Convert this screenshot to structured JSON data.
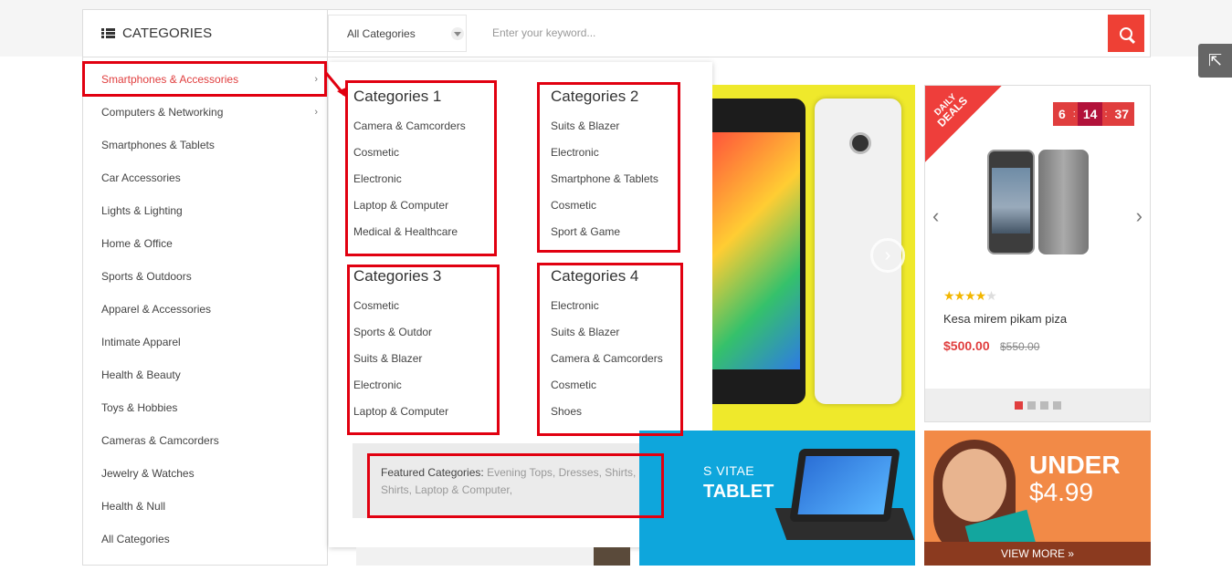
{
  "header": {
    "categories_title": "CATEGORIES",
    "search": {
      "select_value": "All Categories",
      "placeholder": "Enter your keyword..."
    }
  },
  "sidebar": {
    "items": [
      {
        "label": "Smartphones & Accessories",
        "has_sub": true
      },
      {
        "label": "Computers & Networking",
        "has_sub": true
      },
      {
        "label": "Smartphones & Tablets"
      },
      {
        "label": "Car Accessories"
      },
      {
        "label": "Lights & Lighting"
      },
      {
        "label": "Home & Office"
      },
      {
        "label": "Sports & Outdoors"
      },
      {
        "label": "Apparel & Accessories"
      },
      {
        "label": "Intimate Apparel"
      },
      {
        "label": "Health & Beauty"
      },
      {
        "label": "Toys & Hobbies"
      },
      {
        "label": "Cameras & Camcorders"
      },
      {
        "label": "Jewelry & Watches"
      },
      {
        "label": "Health & Null"
      },
      {
        "label": "All Categories"
      }
    ]
  },
  "mega": {
    "columns": [
      {
        "title": "Categories 1",
        "links": [
          "Camera & Camcorders",
          "Cosmetic",
          "Electronic",
          "Laptop & Computer",
          "Medical & Healthcare"
        ]
      },
      {
        "title": "Categories 2",
        "links": [
          "Suits & Blazer",
          "Electronic",
          "Smartphone & Tablets",
          "Cosmetic",
          "Sport & Game"
        ]
      },
      {
        "title": "Categories 3",
        "links": [
          "Cosmetic",
          "Sports & Outdor",
          "Suits & Blazer",
          "Electronic",
          "Laptop & Computer"
        ]
      },
      {
        "title": "Categories 4",
        "links": [
          "Electronic",
          "Suits & Blazer",
          "Camera & Camcorders",
          "Cosmetic",
          "Shoes"
        ]
      }
    ],
    "featured": {
      "label": "Featured Categories:",
      "links": [
        "Evening Tops,",
        "Dresses,",
        "Shirts,",
        "Shirts,",
        "Laptop & Computer,"
      ]
    }
  },
  "deal": {
    "ribbon_line1": "DAILY",
    "ribbon_line2": "DEALS",
    "timer": {
      "hours": "6",
      "minutes": "14",
      "seconds": "37",
      "sep": ":"
    },
    "rating": 4,
    "stars_filled": "★★★★",
    "stars_empty": "★",
    "product_name": "Kesa mirem pikam piza",
    "price": "$500.00",
    "old_price": "$550.00",
    "prev_icon": "‹",
    "next_icon": "›"
  },
  "banners": {
    "tablet_line1": "S VITAE",
    "tablet_line2": "TABLET",
    "under_line1": "UNDER",
    "under_line2": "$4.99",
    "view_more": "VIEW MORE »",
    "slider_next": "›"
  },
  "side_button_icon": "⇱",
  "colors": {
    "accent": "#e03e3e",
    "highlight": "#e10010",
    "banner_yellow": "#efe92b",
    "banner_blue": "#0ea6dc",
    "banner_orange": "#f28a47"
  }
}
